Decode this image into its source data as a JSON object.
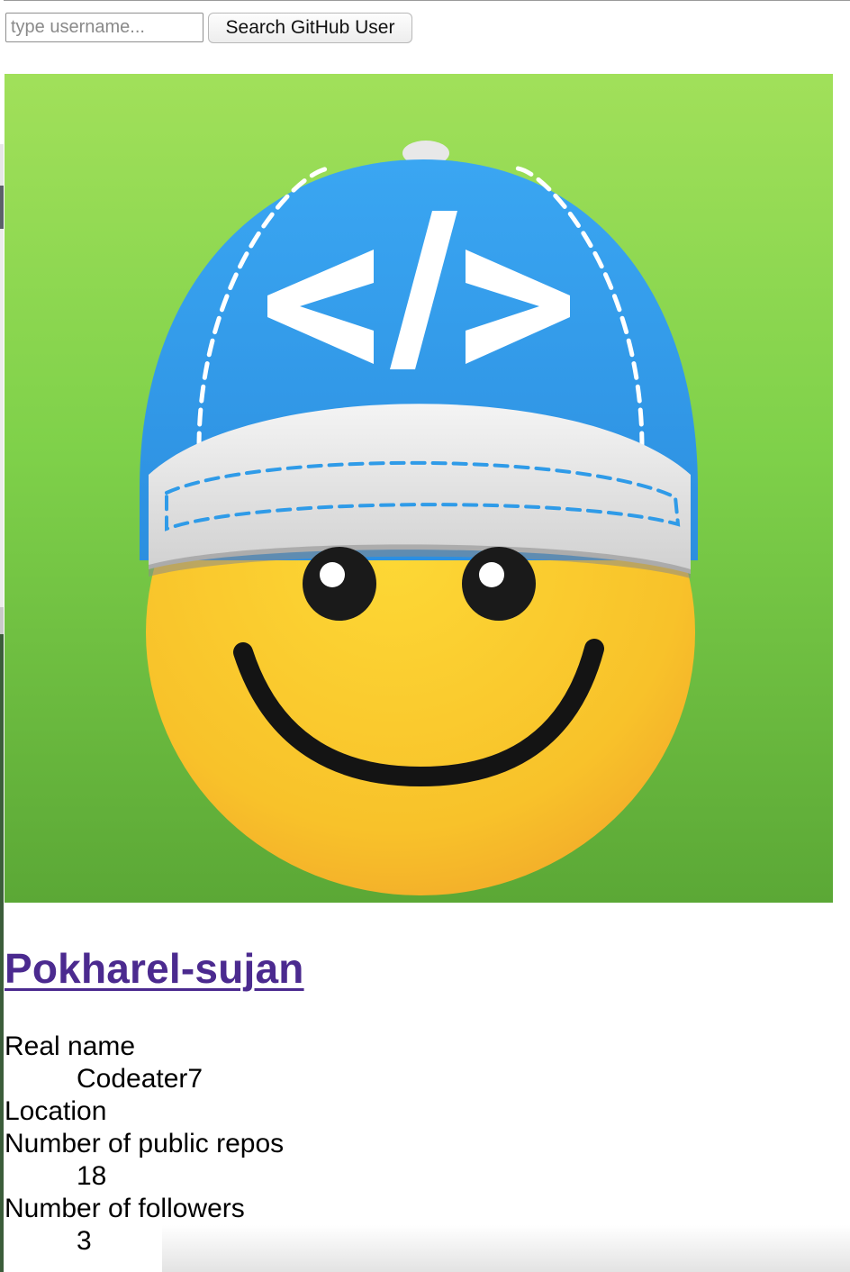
{
  "search": {
    "placeholder": "type username...",
    "value": "",
    "button_label": "Search GitHub User"
  },
  "avatar": {
    "icon": "smiley-coder-cap-avatar",
    "cap_symbol": "</>",
    "colors": {
      "background": "#5ab73a",
      "cap": "#2f9be8",
      "face": "#f6c21f"
    }
  },
  "user": {
    "username": "Pokharel-sujan",
    "fields": [
      {
        "label": "Real name",
        "value": "Codeater7"
      },
      {
        "label": "Location",
        "value": ""
      },
      {
        "label": "Number of public repos",
        "value": "18"
      },
      {
        "label": "Number of followers",
        "value": "3"
      }
    ]
  },
  "colors": {
    "link": "#4b2a8f"
  }
}
